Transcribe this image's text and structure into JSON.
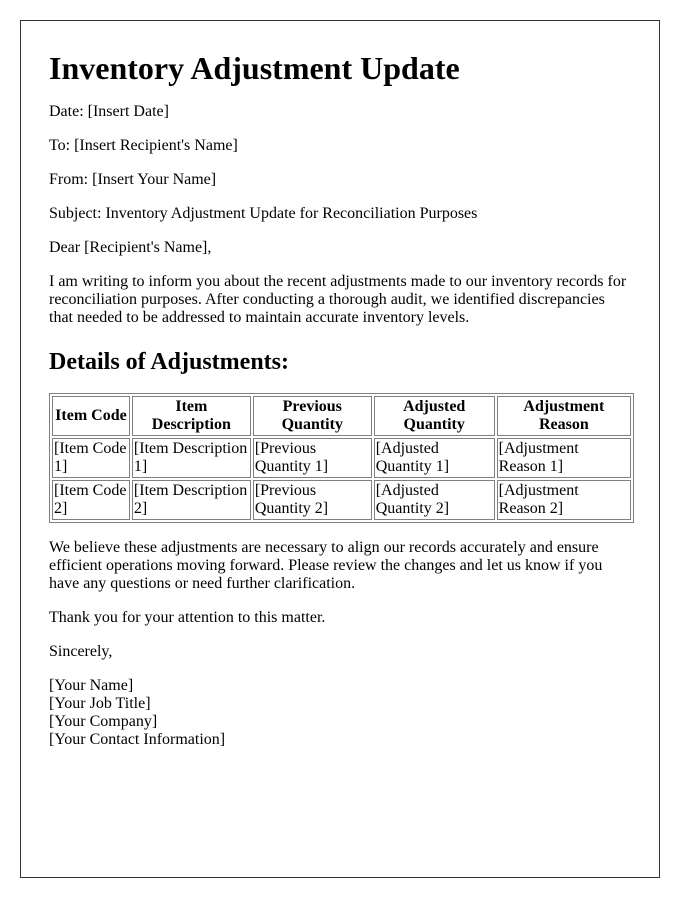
{
  "title": "Inventory Adjustment Update",
  "meta": {
    "date": "Date: [Insert Date]",
    "to": "To: [Insert Recipient's Name]",
    "from": "From: [Insert Your Name]",
    "subject": "Subject: Inventory Adjustment Update for Reconciliation Purposes"
  },
  "salutation": "Dear [Recipient's Name],",
  "intro": "I am writing to inform you about the recent adjustments made to our inventory records for reconciliation purposes. After conducting a thorough audit, we identified discrepancies that needed to be addressed to maintain accurate inventory levels.",
  "details_heading": "Details of Adjustments:",
  "table": {
    "headers": [
      "Item Code",
      "Item Description",
      "Previous Quantity",
      "Adjusted Quantity",
      "Adjustment Reason"
    ],
    "rows": [
      [
        "[Item Code 1]",
        "[Item Description 1]",
        "[Previous Quantity 1]",
        "[Adjusted Quantity 1]",
        "[Adjustment Reason 1]"
      ],
      [
        "[Item Code 2]",
        "[Item Description 2]",
        "[Previous Quantity 2]",
        "[Adjusted Quantity 2]",
        "[Adjustment Reason 2]"
      ]
    ]
  },
  "closing_paragraph": "We believe these adjustments are necessary to align our records accurately and ensure efficient operations moving forward. Please review the changes and let us know if you have any questions or need further clarification.",
  "thanks": "Thank you for your attention to this matter.",
  "signoff": "Sincerely,",
  "signature": {
    "name": "[Your Name]",
    "job_title": "[Your Job Title]",
    "company": "[Your Company]",
    "contact": "[Your Contact Information]"
  }
}
